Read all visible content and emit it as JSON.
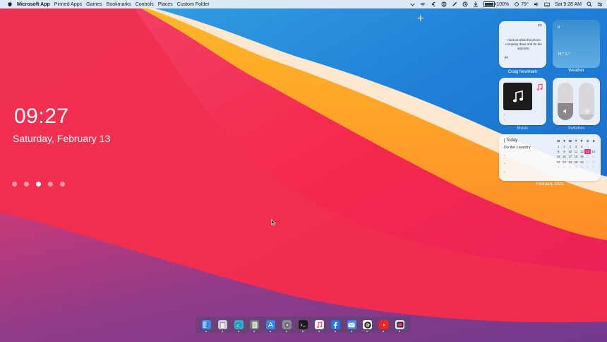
{
  "menubar": {
    "app_name": "Microsoft App",
    "items": [
      "Pinned Apps",
      "Games",
      "Bookmarks",
      "Controls",
      "Places",
      "Custom Folder"
    ],
    "battery_percent": "100%",
    "battery_level": 1.0,
    "temperature": "79°",
    "datetime": "Sat 9:28 AM"
  },
  "lockscreen": {
    "time": "09:27",
    "date": "Saturday, February 13",
    "pager_count": 5,
    "pager_active_index": 2
  },
  "add_widget_symbol": "+",
  "widgets": {
    "quote": {
      "text": "I look at what the phone company does and do the opposite.",
      "author": "Craig Newmark",
      "open_mark": "“",
      "close_mark": "”"
    },
    "weather": {
      "label": "Weather",
      "city": "o",
      "highlow": "H:° L:°"
    },
    "music": {
      "label": "Music",
      "line1": "-",
      "line2": "-"
    },
    "switches": {
      "label": "Switches",
      "volume_level": 0.45,
      "brightness_level": 0.15
    },
    "calendar": {
      "today_label": "| Today",
      "task": "Do the Laundry",
      "placeholders": [
        "-",
        "-",
        "-"
      ],
      "month_label": "February 2021",
      "weekdays": [
        "M",
        "T",
        "W",
        "T",
        "F",
        "S",
        "S"
      ],
      "weeks": [
        [
          "1",
          "2",
          "3",
          "4",
          "5",
          "6",
          "7"
        ],
        [
          "8",
          "9",
          "10",
          "11",
          "12",
          "13",
          "14"
        ],
        [
          "15",
          "16",
          "17",
          "18",
          "19",
          "20",
          "21"
        ],
        [
          "22",
          "23",
          "24",
          "25",
          "26",
          "27",
          "28"
        ],
        [
          "1",
          "2",
          "3",
          "4",
          "5",
          "6",
          "7"
        ]
      ],
      "today_date": "13"
    }
  },
  "dock": {
    "apps": [
      {
        "name": "finder-icon",
        "color": "#3a8ee6"
      },
      {
        "name": "trash-icon",
        "color": "#c9ccd2"
      },
      {
        "name": "edge-icon",
        "color": "#2bb3c9"
      },
      {
        "name": "notes-icon",
        "color": "#777a80"
      },
      {
        "name": "app-store-icon",
        "color": "#2f8cf0"
      },
      {
        "name": "settings-icon",
        "color": "#8a8f96"
      },
      {
        "name": "terminal-icon",
        "color": "#1b1b1b"
      },
      {
        "name": "music-icon",
        "color": "#f4f4f6"
      },
      {
        "name": "facebook-icon",
        "color": "#1877f2"
      },
      {
        "name": "mail-icon",
        "color": "#3d8cf0"
      },
      {
        "name": "google-icon",
        "color": "#ffffff"
      },
      {
        "name": "youtube-icon",
        "color": "#ff1f1f"
      },
      {
        "name": "screen-icon",
        "color": "#e8e8ee"
      }
    ]
  }
}
